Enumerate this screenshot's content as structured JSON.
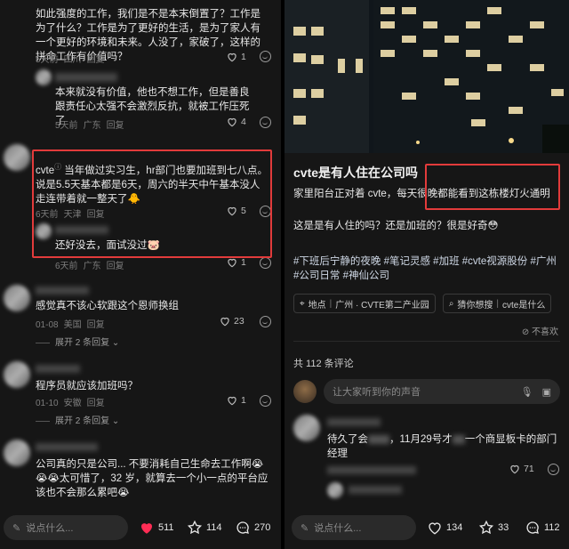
{
  "left": {
    "comments": [
      {
        "text": "如此强度的工作，我们是不是本末倒置了？工作是为了什么？工作是为了更好的生活，是为了家人有一个更好的环境和未来。人没了，家破了，这样的拼命工作有价值吗？",
        "time": "5天前",
        "location": "四川",
        "reply": "回复",
        "likes": "1"
      },
      {
        "text": "本来就没有价值，他也不想工作，但是善良跟责任心太强不会激烈反抗，就被工作压死了",
        "time": "5天前",
        "location": "广东",
        "reply": "回复",
        "likes": "4"
      },
      {
        "author": "cvte",
        "text": "当年做过实习生，hr部门也要加班到七八点。说是5.5天基本都是6天，周六的半天中午基本没人走连带着就一整天了",
        "emoji": "🐥",
        "time": "6天前",
        "location": "天津",
        "reply": "回复",
        "likes": "5"
      },
      {
        "text": "还好没去，面试没过",
        "emoji": "🐷",
        "time": "6天前",
        "location": "广东",
        "reply": "回复",
        "likes": "1"
      },
      {
        "text": "感觉真不该心软跟这个恩师换组",
        "time": "01-08",
        "location": "美国",
        "reply": "回复",
        "likes": "23",
        "expand": "展开 2 条回复"
      },
      {
        "text": "程序员就应该加班吗？",
        "time": "01-10",
        "location": "安徽",
        "reply": "回复",
        "likes": "1",
        "expand": "展开 2 条回复"
      },
      {
        "text": "公司真的只是公司... 不要消耗自己生命去工作啊",
        "emoji": "😭😭😭",
        "text2": "太可惜了，32 岁，就算去一个小一点的平台应该也不会那么累吧",
        "emoji2": "😭"
      }
    ],
    "bottom": {
      "placeholder": "说点什么...",
      "likes": "511",
      "stars": "114",
      "comments": "270"
    }
  },
  "right": {
    "post_title": "cvte是有人住在公司吗",
    "post_body_1": "家里阳台正对着 cvte，每天很晚都能看到这栋楼灯火通明",
    "post_body_2": "这是是有人住的吗？还是加班的？很是好奇",
    "post_emoji": "😳",
    "hashtags": "#下班后宁静的夜晚 #笔记灵感 #加班 #cvte视源股份 #广州 #公司日常 #神仙公司",
    "location_label": "地点",
    "location_value": "广州 · CVTE第二产业园",
    "guess_label": "猜你想搜",
    "guess_value": "cvte是什么",
    "dislike": "不喜欢",
    "comment_count": "共 112 条评论",
    "comment_placeholder": "让大家听到你的声音",
    "comment": {
      "text_a": "待久了会",
      "text_b": "，11月29号才",
      "text_c": "一个商显板卡的部门经理",
      "likes": "71"
    },
    "bottom": {
      "placeholder": "说点什么...",
      "likes": "134",
      "stars": "33",
      "comments": "112"
    }
  },
  "colors": {
    "highlight_box": "#e23b3b",
    "like_red": "#ff2d55"
  }
}
